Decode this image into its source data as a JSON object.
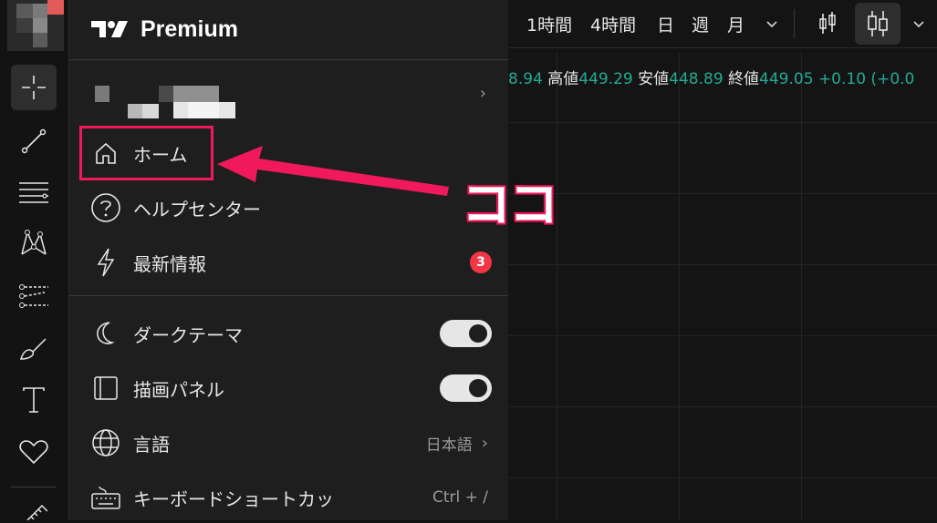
{
  "toolbar": {
    "timeframes": [
      "1時間",
      "4時間",
      "日",
      "週",
      "月"
    ]
  },
  "ohlc": {
    "open_value_partial": "8.94",
    "high_label": "高値",
    "high_value": "449.29",
    "low_label": "安値",
    "low_value": "448.89",
    "close_label": "終値",
    "close_value": "449.05",
    "change": "+0.10 (+0.0"
  },
  "menu": {
    "brand": "Premium",
    "items": [
      {
        "label": "ホーム",
        "icon": "home-icon"
      },
      {
        "label": "ヘルプセンター",
        "icon": "help-icon"
      },
      {
        "label": "最新情報",
        "icon": "lightning-icon",
        "badge": "3"
      }
    ],
    "settings": [
      {
        "label": "ダークテーマ",
        "icon": "moon-icon",
        "toggle": true
      },
      {
        "label": "描画パネル",
        "icon": "panel-icon",
        "toggle": true
      },
      {
        "label": "言語",
        "icon": "globe-icon",
        "value": "日本語"
      },
      {
        "label": "キーボードショートカッ",
        "icon": "keyboard-icon",
        "shortcut": "Ctrl + /"
      }
    ]
  },
  "annotation": {
    "callout": "ココ",
    "color": "#f0195b"
  },
  "colors": {
    "positive": "#22ab94",
    "badge": "#f23645"
  }
}
